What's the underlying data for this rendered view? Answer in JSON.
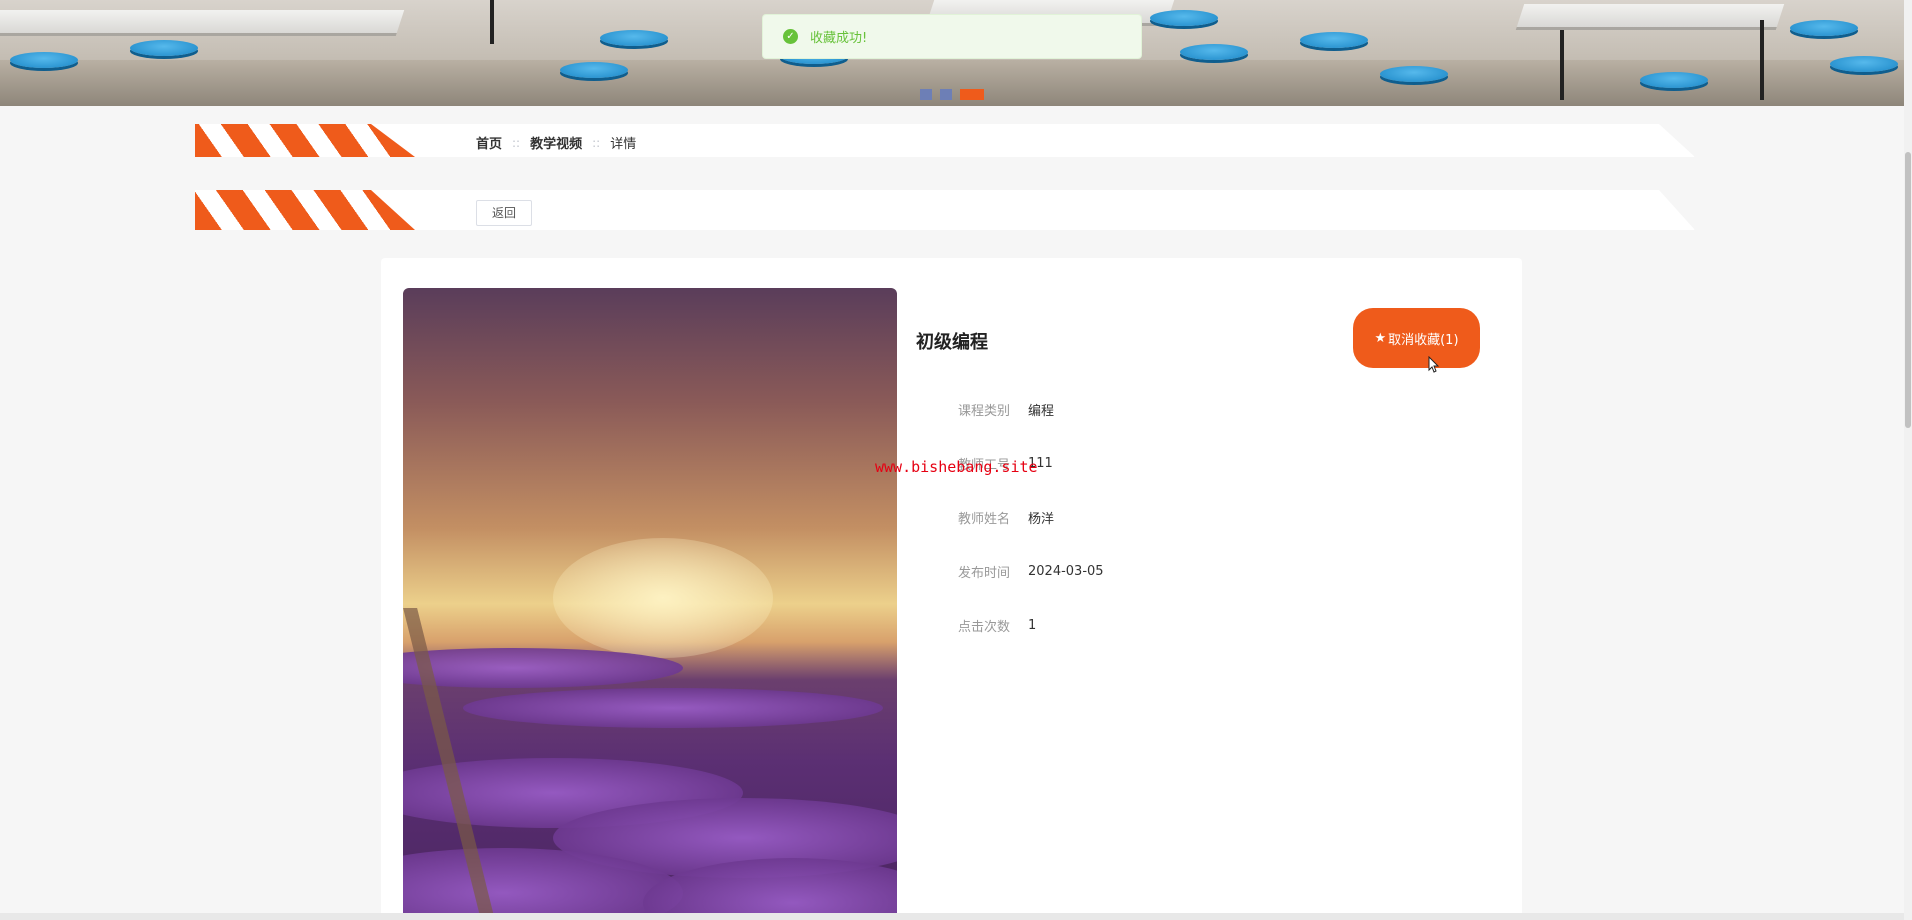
{
  "toast": {
    "message": "收藏成功!",
    "icon": "check-circle-icon",
    "color": "#67c23a"
  },
  "banner": {
    "dots": 3,
    "active_dot": 3
  },
  "breadcrumb": {
    "home": "首页",
    "sep1": "::",
    "section": "教学视频",
    "sep2": "::",
    "current": "详情"
  },
  "toolbar": {
    "back_label": "返回"
  },
  "course": {
    "title": "初级编程",
    "fav_star": "★",
    "fav_label": "取消收藏(1)",
    "fields": [
      {
        "label": "课程类别",
        "value": "编程"
      },
      {
        "label": "教师工号",
        "value": "111"
      },
      {
        "label": "教师姓名",
        "value": "杨洋"
      },
      {
        "label": "发布时间",
        "value": "2024-03-05"
      },
      {
        "label": "点击次数",
        "value": "1"
      }
    ]
  },
  "gallery": {
    "prev": "‹",
    "next": "›"
  },
  "watermark": "www.bishebang.site",
  "colors": {
    "accent": "#ef5b1b",
    "dot": "#6d7fb6"
  }
}
